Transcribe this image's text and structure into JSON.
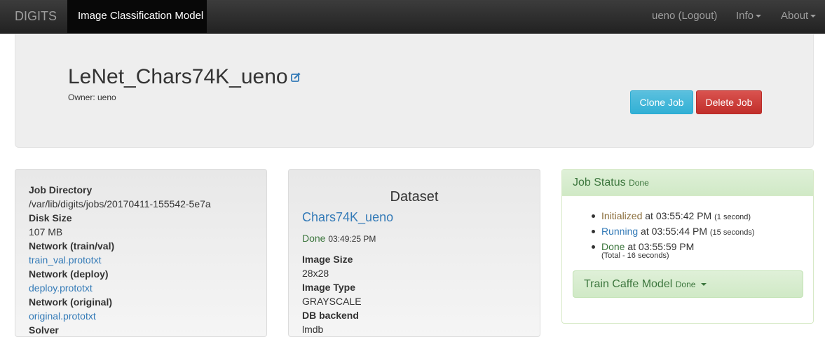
{
  "navbar": {
    "brand": "DIGITS",
    "active_page": "Image Classification Model",
    "user_link": "ueno (Logout)",
    "info_menu": "Info",
    "about_menu": "About"
  },
  "header": {
    "job_name": "LeNet_Chars74K_ueno",
    "owner": "Owner: ueno",
    "clone_button": "Clone Job",
    "delete_button": "Delete Job"
  },
  "job_info": {
    "items": [
      {
        "label": "Job Directory",
        "value": "/var/lib/digits/jobs/20170411-155542-5e7a",
        "link": false
      },
      {
        "label": "Disk Size",
        "value": "107 MB",
        "link": false
      },
      {
        "label": "Network (train/val)",
        "value": "train_val.prototxt",
        "link": true
      },
      {
        "label": "Network (deploy)",
        "value": "deploy.prototxt",
        "link": true
      },
      {
        "label": "Network (original)",
        "value": "original.prototxt",
        "link": true
      },
      {
        "label": "Solver",
        "value": "",
        "link": false
      }
    ]
  },
  "dataset": {
    "heading": "Dataset",
    "name": "Chars74K_ueno",
    "status": "Done",
    "time": "03:49:25 PM",
    "items": [
      {
        "label": "Image Size",
        "value": "28x28"
      },
      {
        "label": "Image Type",
        "value": "GRAYSCALE"
      },
      {
        "label": "DB backend",
        "value": "lmdb"
      }
    ]
  },
  "job_status": {
    "title": "Job Status",
    "state": "Done",
    "events": [
      {
        "name": "Initialized",
        "at": "at 03:55:42 PM",
        "duration": "(1 second)"
      },
      {
        "name": "Running",
        "at": "at 03:55:44 PM",
        "duration": "(15 seconds)"
      },
      {
        "name": "Done",
        "at": "at 03:55:59 PM",
        "duration": ""
      }
    ],
    "total": "(Total - 16 seconds)",
    "train_task": "Train Caffe Model",
    "train_state": "Done"
  },
  "colors": {
    "navbar_bg": "#222222",
    "link": "#337ab7",
    "success": "#3c763d",
    "info_button": "#5bc0de",
    "danger_button": "#d9534f"
  }
}
